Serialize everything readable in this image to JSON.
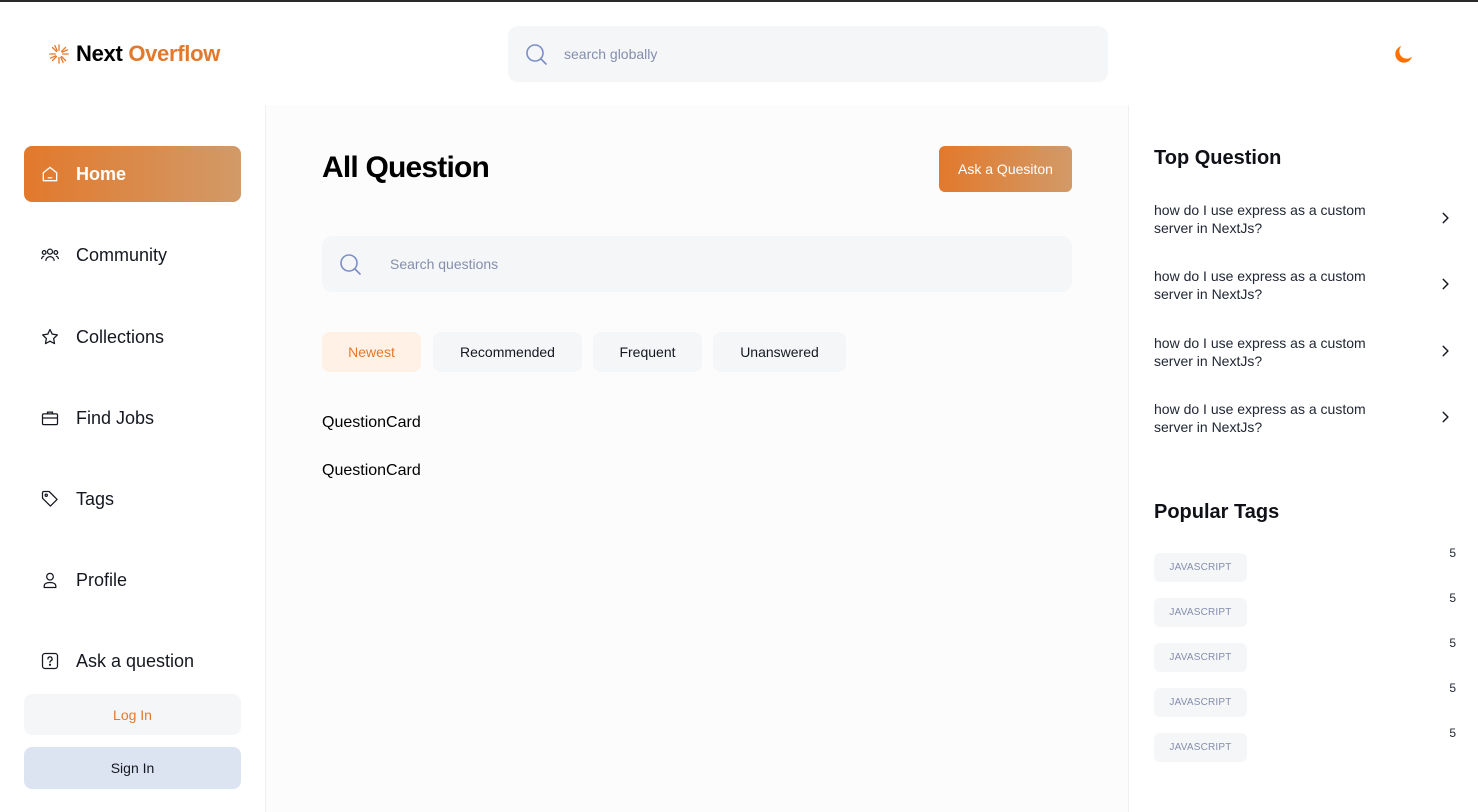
{
  "navbar": {
    "logo_prefix": "Next",
    "logo_accent": "Overflow",
    "search_placeholder": "search globally",
    "theme_icon": "moon-icon"
  },
  "sidebar": {
    "items": [
      {
        "label": "Home",
        "icon": "home-icon",
        "active": true
      },
      {
        "label": "Community",
        "icon": "users-icon"
      },
      {
        "label": "Collections",
        "icon": "star-icon"
      },
      {
        "label": "Find Jobs",
        "icon": "briefcase-icon"
      },
      {
        "label": "Tags",
        "icon": "tag-icon"
      },
      {
        "label": "Profile",
        "icon": "user-icon"
      },
      {
        "label": "Ask a question",
        "icon": "question-icon"
      }
    ],
    "login_label": "Log In",
    "signin_label": "Sign In"
  },
  "main": {
    "title": "All Question",
    "ask_button": "Ask a Quesiton",
    "search_placeholder": "Search questions",
    "filters": [
      {
        "label": "Newest",
        "active": true
      },
      {
        "label": "Recommended"
      },
      {
        "label": "Frequent"
      },
      {
        "label": "Unanswered"
      }
    ],
    "cards": [
      "QuestionCard",
      "QuestionCard"
    ]
  },
  "right": {
    "top_title": "Top Question",
    "top_questions": [
      "how do I use express as a custom server in NextJs?",
      "how do I use express as a custom server in NextJs?",
      "how do I use express as a custom server in NextJs?",
      "how do I use express as a custom server in NextJs?"
    ],
    "tags_title": "Popular Tags",
    "tags": [
      {
        "name": "JAVASCRIPT",
        "count": "5"
      },
      {
        "name": "JAVASCRIPT",
        "count": "5"
      },
      {
        "name": "JAVASCRIPT",
        "count": "5"
      },
      {
        "name": "JAVASCRIPT",
        "count": "5"
      },
      {
        "name": "JAVASCRIPT",
        "count": "5"
      }
    ]
  },
  "colors": {
    "accent": "#e2792c",
    "accent_light": "#d29a68",
    "muted": "#858ead"
  }
}
